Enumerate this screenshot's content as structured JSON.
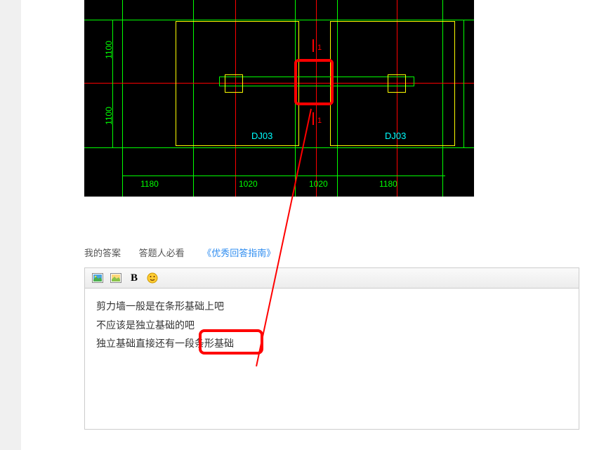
{
  "cad": {
    "label_left": "DJ03",
    "label_right": "DJ03",
    "section_mark": "1",
    "dims_bottom": [
      "1180",
      "1020",
      "1020",
      "1180"
    ],
    "dims_left": [
      "1100",
      "1100"
    ]
  },
  "tabs": {
    "my_answer": "我的答案",
    "must_read": "答题人必看",
    "guide_full": "《优秀回答指南》"
  },
  "toolbar": {
    "bold": "B"
  },
  "editor": {
    "line1": "剪力墙一般是在条形基础上吧",
    "line2": "不应该是独立基础的吧",
    "line3": "独立基础直接还有一段条形基础"
  }
}
